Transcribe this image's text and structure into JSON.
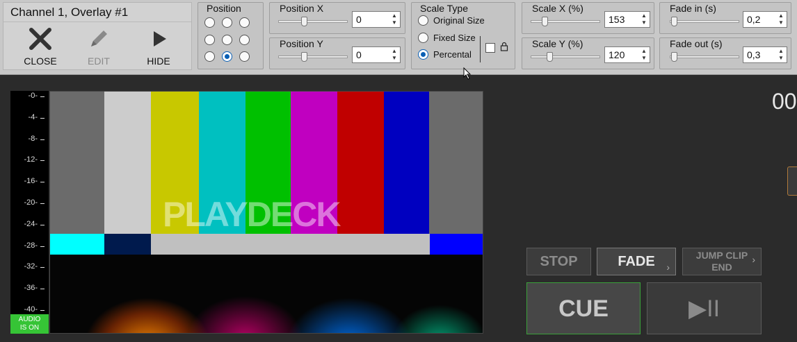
{
  "overlay": {
    "title": "Channel 1, Overlay #1",
    "buttons": [
      {
        "label": "CLOSE",
        "icon": "close-icon",
        "enabled": true
      },
      {
        "label": "EDIT",
        "icon": "edit-icon",
        "enabled": false
      },
      {
        "label": "HIDE",
        "icon": "play-icon",
        "enabled": true
      }
    ]
  },
  "position": {
    "label": "Position",
    "selected_index": 7
  },
  "position_x": {
    "label": "Position X",
    "value": "0"
  },
  "position_y": {
    "label": "Position Y",
    "value": "0"
  },
  "scale_type": {
    "label": "Scale Type",
    "options": [
      "Original Size",
      "Fixed Size",
      "Percental"
    ],
    "selected": "Percental"
  },
  "scale_x": {
    "label": "Scale X (%)",
    "value": "153"
  },
  "scale_y": {
    "label": "Scale Y (%)",
    "value": "120"
  },
  "fade_in": {
    "label": "Fade in (s)",
    "value": "0,2"
  },
  "fade_out": {
    "label": "Fade out (s)",
    "value": "0,3"
  },
  "meter": {
    "ticks": [
      "-0-",
      "-4-",
      "-8-",
      "-12-",
      "-16-",
      "-20-",
      "-24-",
      "-28-",
      "-32-",
      "-36-",
      "-40-"
    ],
    "badge_line1": "AUDIO",
    "badge_line2": "IS ON",
    "badge_color": "#36c436"
  },
  "preview": {
    "logo_text": "PLAYDECK",
    "bars_top": [
      "#6b6b6b",
      "#cccccc",
      "#c8c800",
      "#00c0c0",
      "#00c000",
      "#c000c0",
      "#c00000",
      "#0000c0",
      "#6b6b6b"
    ],
    "bars_mid": [
      "#00ffff",
      "#001a4d",
      "#c0c0c0",
      "#0000ff"
    ]
  },
  "clock": {
    "text": "00"
  },
  "controls": {
    "stop": "STOP",
    "fade": "FADE",
    "jump_line1": "JUMP CLIP",
    "jump_line2": "END",
    "cue": "CUE",
    "play_pause": "▶II"
  }
}
